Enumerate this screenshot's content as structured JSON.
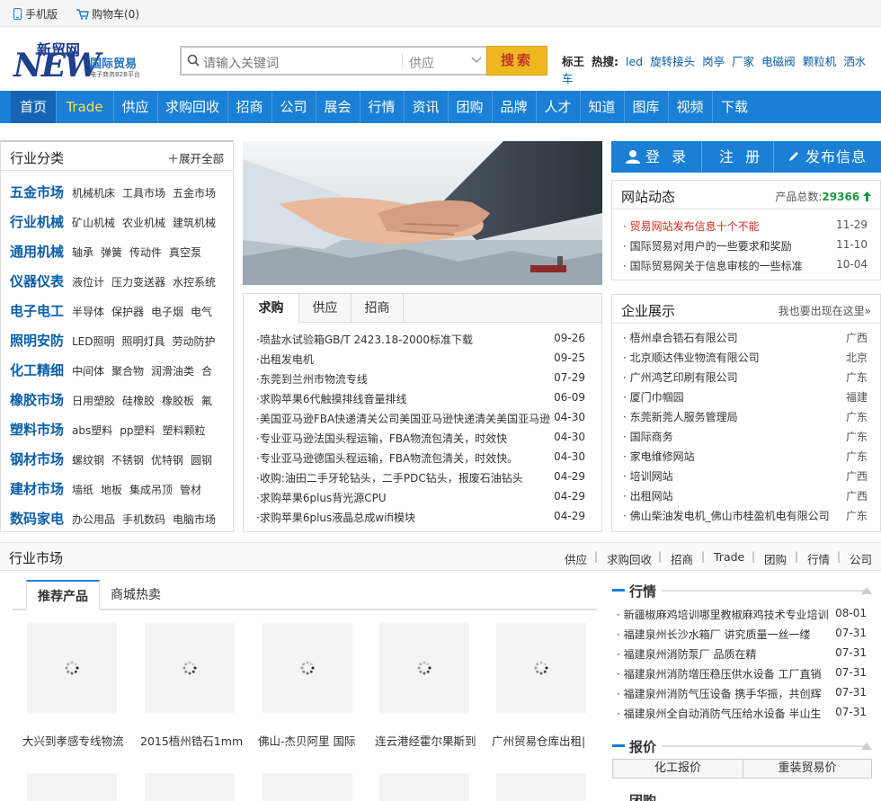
{
  "topbar": {
    "mobile": "手机版",
    "cart": "购物车(0)"
  },
  "logo": {
    "text1": "新贸网",
    "text2": "NEW",
    "text3": "国际贸易",
    "text4": "电子商务B2B平台"
  },
  "search": {
    "placeholder": "请输入关键词",
    "category": "供应",
    "button": "搜索"
  },
  "hot": {
    "label1": "标王",
    "label2": "热搜:",
    "keywords": [
      "led",
      "旋转接头",
      "岗亭",
      "厂家",
      "电磁阀",
      "颗粒机",
      "洒水车"
    ]
  },
  "nav": [
    "首页",
    "Trade",
    "供应",
    "求购回收",
    "招商",
    "公司",
    "展会",
    "行情",
    "资讯",
    "团购",
    "品牌",
    "人才",
    "知道",
    "图库",
    "视频",
    "下载"
  ],
  "category": {
    "title": "行业分类",
    "expand": "展开全部",
    "rows": [
      {
        "name": "五金市场",
        "subs": [
          "机械机床",
          "工具市场",
          "五金市场"
        ]
      },
      {
        "name": "行业机械",
        "subs": [
          "矿山机械",
          "农业机械",
          "建筑机械"
        ]
      },
      {
        "name": "通用机械",
        "subs": [
          "轴承",
          "弹簧",
          "传动件",
          "真空泵"
        ]
      },
      {
        "name": "仪器仪表",
        "subs": [
          "液位计",
          "压力变送器",
          "水控系统"
        ]
      },
      {
        "name": "电子电工",
        "subs": [
          "半导体",
          "保护器",
          "电子烟",
          "电气"
        ]
      },
      {
        "name": "照明安防",
        "subs": [
          "LED照明",
          "照明灯具",
          "劳动防护"
        ]
      },
      {
        "name": "化工精细",
        "subs": [
          "中间体",
          "聚合物",
          "润滑油类",
          "合"
        ]
      },
      {
        "name": "橡胶市场",
        "subs": [
          "日用塑胶",
          "硅橡胶",
          "橡胶板",
          "氟"
        ]
      },
      {
        "name": "塑料市场",
        "subs": [
          "abs塑料",
          "pp塑料",
          "塑料颗粒"
        ]
      },
      {
        "name": "钢材市场",
        "subs": [
          "螺纹钢",
          "不锈钢",
          "优特钢",
          "圆钢"
        ]
      },
      {
        "name": "建材市场",
        "subs": [
          "墙纸",
          "地板",
          "集成吊顶",
          "管材"
        ]
      },
      {
        "name": "数码家电",
        "subs": [
          "办公用品",
          "手机数码",
          "电脑市场"
        ]
      }
    ]
  },
  "news": {
    "tabs": [
      "求购",
      "供应",
      "招商"
    ],
    "items": [
      {
        "title": "·喷盐水试验箱GB/T 2423.18-2000标准下载",
        "date": "09-26"
      },
      {
        "title": "·出租发电机",
        "date": "09-25"
      },
      {
        "title": "·东莞到兰州市物流专线",
        "date": "07-29"
      },
      {
        "title": "·求购苹果6代触摸排线音量排线",
        "date": "06-09"
      },
      {
        "title": "·美国亚马逊FBA快递清关公司美国亚马逊快递清关美国亚马逊",
        "date": "04-30"
      },
      {
        "title": "·专业亚马逊法国头程运输，FBA物流包清关，时效快",
        "date": "04-30"
      },
      {
        "title": "·专业亚马逊德国头程运输，FBA物流包清关，时效快。",
        "date": "04-30"
      },
      {
        "title": "·收购:油田二手牙轮钻头，二手PDC钻头，报废石油钻头",
        "date": "04-29"
      },
      {
        "title": "·求购苹果6plus背光源CPU",
        "date": "04-29"
      },
      {
        "title": "·求购苹果6plus液晶总成wifi模块",
        "date": "04-29"
      }
    ]
  },
  "actions": {
    "login": "登 录",
    "register": "注 册",
    "publish": "发布信息"
  },
  "dynamics": {
    "title": "网站动态",
    "count_label": "产品总数:",
    "count": "29366",
    "items": [
      {
        "title": "· 贸易网站发布信息十个不能",
        "date": "11-29"
      },
      {
        "title": "· 国际贸易对用户的一些要求和奖励",
        "date": "11-10"
      },
      {
        "title": "· 国际贸易网关于信息审核的一些标准",
        "date": "10-04"
      }
    ]
  },
  "enterprise": {
    "title": "企业展示",
    "more": "我也要出现在这里»",
    "items": [
      {
        "name": "· 梧州卓合锆石有限公司",
        "region": "广西"
      },
      {
        "name": "· 北京顺达伟业物流有限公司",
        "region": "北京"
      },
      {
        "name": "· 广州鸿艺印刷有限公司",
        "region": "广东"
      },
      {
        "name": "· 厦门巾帼园",
        "region": "福建"
      },
      {
        "name": "· 东莞新莞人服务管理局",
        "region": "广东"
      },
      {
        "name": "· 国际商务",
        "region": "广东"
      },
      {
        "name": "· 家电维修网站",
        "region": "广东"
      },
      {
        "name": "· 培训网站",
        "region": "广西"
      },
      {
        "name": "· 出租网站",
        "region": "广西"
      },
      {
        "name": "· 佛山柴油发电机_佛山市桂盈机电有限公司",
        "region": "广东"
      }
    ]
  },
  "market": {
    "title": "行业市场",
    "links": [
      "供应",
      "求购回收",
      "招商",
      "Trade",
      "团购",
      "行情",
      "公司"
    ],
    "tabs": [
      "推荐产品",
      "商城热卖"
    ],
    "products": [
      "大兴到孝感专线物流",
      "2015梧州锆石1mm",
      "佛山-杰贝阿里 国际",
      "连云港经霍尔果斯到",
      "广州贸易仓库出租|"
    ],
    "quote_title": "行情",
    "quotes": [
      {
        "title": "· 新疆椒麻鸡培训哪里教椒麻鸡技术专业培训",
        "date": "08-01"
      },
      {
        "title": "· 福建泉州长沙水箱厂 讲究质量一丝一缕",
        "date": "07-31"
      },
      {
        "title": "· 福建泉州消防泵厂 品质在精",
        "date": "07-31"
      },
      {
        "title": "· 福建泉州消防增压稳压供水设备 工厂直销",
        "date": "07-31"
      },
      {
        "title": "· 福建泉州消防气压设备 携手华振，共创辉",
        "date": "07-31"
      },
      {
        "title": "· 福建泉州全自动消防气压给水设备 半山生",
        "date": "07-31"
      }
    ],
    "price_title": "报价",
    "price_buttons": [
      "化工报价",
      "重装贸易价"
    ],
    "group_title": "团购"
  },
  "colors": {
    "accent": "#1a7fd5",
    "brand_dark": "#1f3f8f",
    "red": "#d12a1d",
    "green": "#1a9a3a",
    "search_btn": "#f0b820"
  }
}
